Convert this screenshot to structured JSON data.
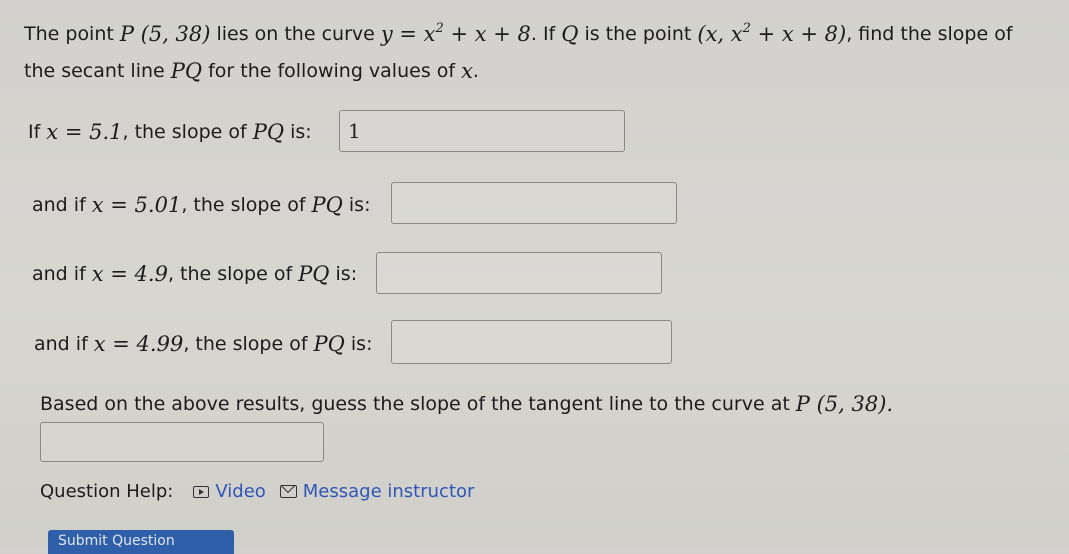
{
  "problem": {
    "intro_text": "The point",
    "point_p": "P (5, 38)",
    "lies_text": "lies on the curve",
    "curve_lhs": "y = x",
    "curve_exp": "2",
    "curve_rhs": " + x + 8",
    "if_q_text": ". If",
    "q_var": "Q",
    "is_point_text": "is the point",
    "q_point_start": "(x, x",
    "q_point_exp": "2",
    "q_point_end": " + x + 8)",
    "find_text": ", find the slope of",
    "line2_text1": "the secant line",
    "line2_pq": "PQ",
    "line2_text2": "for the following values of",
    "line2_x": "x",
    "line2_dot": "."
  },
  "rows": [
    {
      "prefix": "If",
      "x_expr": "x = 5.1",
      "suffix": ", the slope of",
      "pq": "PQ",
      "is_text": "is:",
      "value": "1"
    },
    {
      "prefix": "and if",
      "x_expr": "x = 5.01",
      "suffix": ", the slope of",
      "pq": "PQ",
      "is_text": "is:",
      "value": ""
    },
    {
      "prefix": "and if",
      "x_expr": "x = 4.9",
      "suffix": ", the slope of",
      "pq": "PQ",
      "is_text": "is:",
      "value": ""
    },
    {
      "prefix": "and if",
      "x_expr": "x = 4.99",
      "suffix": ", the slope of",
      "pq": "PQ",
      "is_text": "is:",
      "value": ""
    }
  ],
  "tangent": {
    "text": "Based on the above results, guess the slope of the tangent line to the curve at",
    "point": "P (5, 38).",
    "value": ""
  },
  "help": {
    "label": "Question Help:",
    "video_label": "Video",
    "message_label": "Message instructor"
  },
  "submit": {
    "label": "Submit Question"
  },
  "colors": {
    "link": "#2f56b5",
    "submit_bg": "#2f5fa8",
    "background": "#d5d4cf"
  }
}
